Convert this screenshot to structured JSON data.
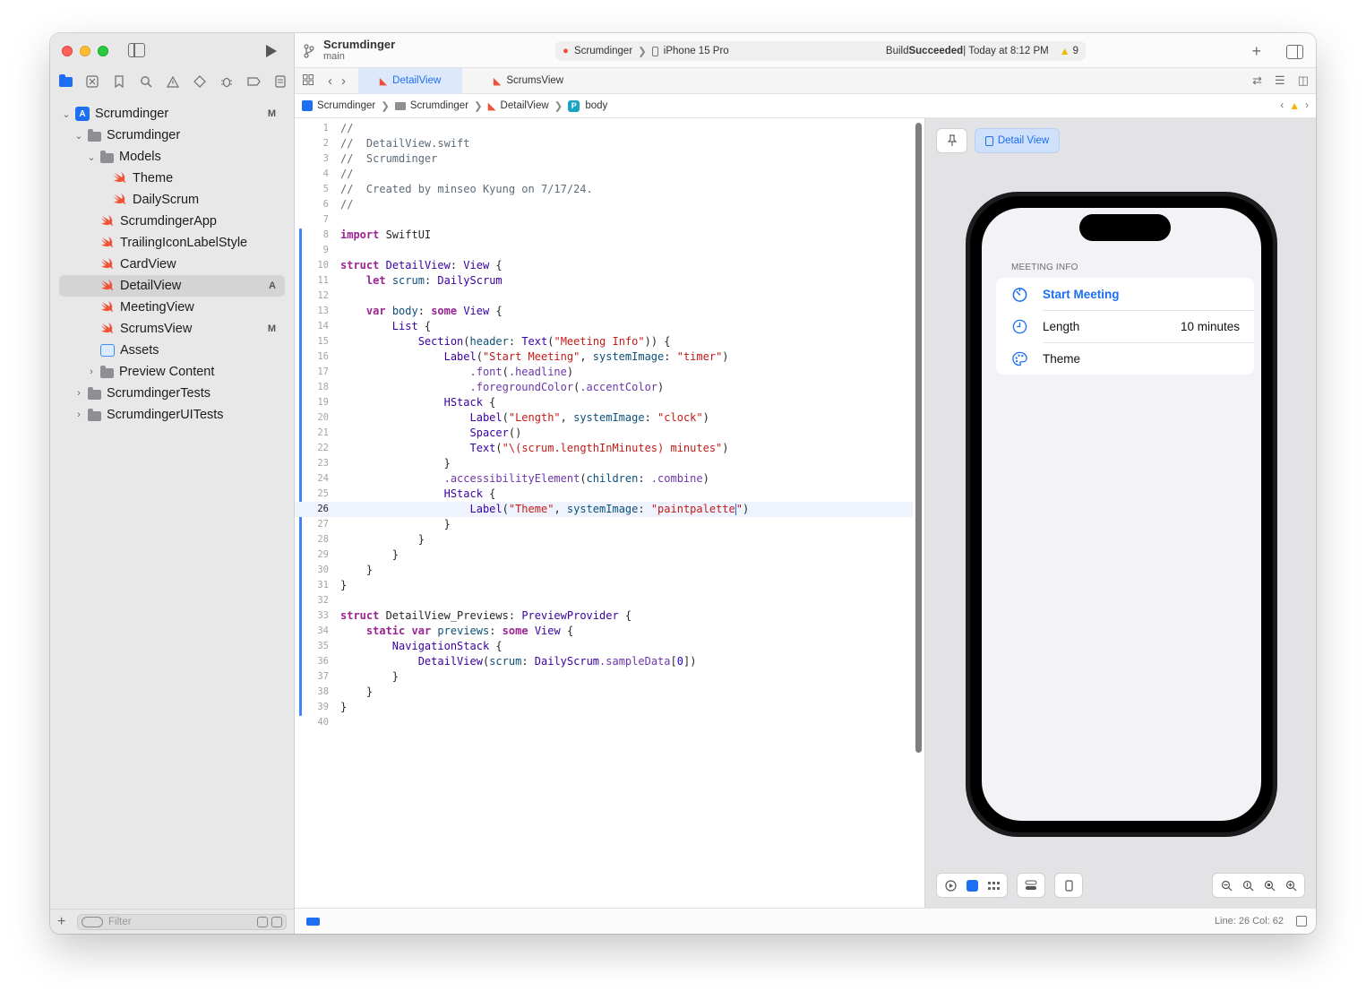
{
  "toolbar": {
    "project": "Scrumdinger",
    "branch": "main",
    "scheme": "Scrumdinger",
    "device": "iPhone 15 Pro",
    "build_prefix": "Build ",
    "build_status": "Succeeded",
    "build_time": " | Today at 8:12 PM",
    "warning_count": "9"
  },
  "tabs": [
    {
      "label": "DetailView",
      "active": true
    },
    {
      "label": "ScrumsView",
      "active": false
    }
  ],
  "breadcrumb": [
    "Scrumdinger",
    "Scrumdinger",
    "DetailView",
    "body"
  ],
  "navigator": {
    "items": [
      {
        "label": "Scrumdinger",
        "badge": "M"
      },
      {
        "label": "Scrumdinger"
      },
      {
        "label": "Models"
      },
      {
        "label": "Theme"
      },
      {
        "label": "DailyScrum"
      },
      {
        "label": "ScrumdingerApp"
      },
      {
        "label": "TrailingIconLabelStyle"
      },
      {
        "label": "CardView"
      },
      {
        "label": "DetailView",
        "badge": "A"
      },
      {
        "label": "MeetingView"
      },
      {
        "label": "ScrumsView",
        "badge": "M"
      },
      {
        "label": "Assets"
      },
      {
        "label": "Preview Content"
      },
      {
        "label": "ScrumdingerTests"
      },
      {
        "label": "ScrumdingerUITests"
      }
    ],
    "filter_placeholder": "Filter"
  },
  "code_lines": [
    "//",
    "//  DetailView.swift",
    "//  Scrumdinger",
    "//",
    "//  Created by minseo Kyung on 7/17/24.",
    "//",
    "",
    "import SwiftUI",
    "",
    "struct DetailView: View {",
    "    let scrum: DailyScrum",
    "",
    "    var body: some View {",
    "        List {",
    "            Section(header: Text(\"Meeting Info\")) {",
    "                Label(\"Start Meeting\", systemImage: \"timer\")",
    "                    .font(.headline)",
    "                    .foregroundColor(.accentColor)",
    "                HStack {",
    "                    Label(\"Length\", systemImage: \"clock\")",
    "                    Spacer()",
    "                    Text(\"\\(scrum.lengthInMinutes) minutes\")",
    "                }",
    "                .accessibilityElement(children: .combine)",
    "                HStack {",
    "                    Label(\"Theme\", systemImage: \"paintpalette\")",
    "                }",
    "            }",
    "        }",
    "    }",
    "}",
    "",
    "struct DetailView_Previews: PreviewProvider {",
    "    static var previews: some View {",
    "        NavigationStack {",
    "            DetailView(scrum: DailyScrum.sampleData[0])",
    "        }",
    "    }",
    "}",
    ""
  ],
  "current_line": 26,
  "preview": {
    "chip_label": "Detail View",
    "section_header": "MEETING INFO",
    "rows": [
      {
        "label": "Start Meeting",
        "value": ""
      },
      {
        "label": "Length",
        "value": "10 minutes"
      },
      {
        "label": "Theme",
        "value": ""
      }
    ]
  },
  "statusbar": {
    "cursor": "Line: 26  Col: 62"
  },
  "colors": {
    "accent": "#1d6ff2",
    "swift": "#f05138",
    "warning": "#f2b600"
  }
}
